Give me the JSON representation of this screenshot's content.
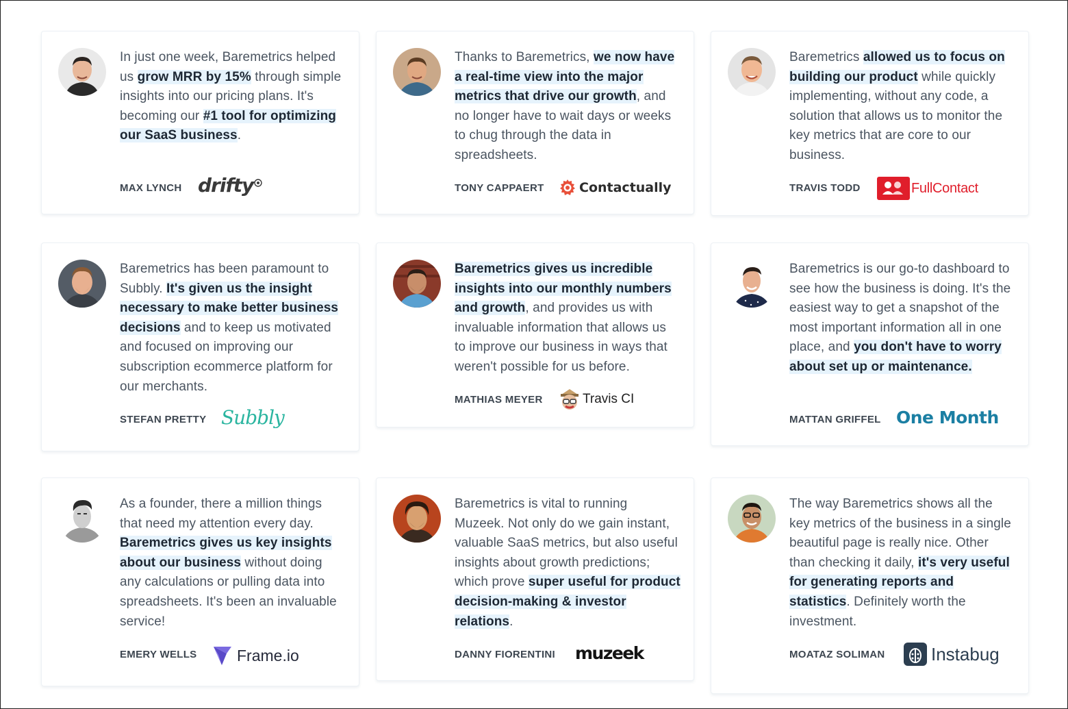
{
  "testimonials": [
    {
      "quote": [
        {
          "text": "In just one week, Baremetrics helped us ",
          "hl": false
        },
        {
          "text": "grow MRR by 15%",
          "hl": true
        },
        {
          "text": " through simple insights into our pricing plans. It's becoming our ",
          "hl": false
        },
        {
          "text": "#1 tool for optimizing our SaaS business",
          "hl": true
        },
        {
          "text": ".",
          "hl": false
        }
      ],
      "author": "MAX LYNCH",
      "logo": {
        "name": "drifty-logo",
        "text": "drifty",
        "color": "#3a3a3a"
      }
    },
    {
      "quote": [
        {
          "text": "Thanks to Baremetrics, ",
          "hl": false
        },
        {
          "text": "we now have a real-time view into the major metrics that drive our growth",
          "hl": true
        },
        {
          "text": ", and no longer have to wait days or weeks to chug through the data in spreadsheets.",
          "hl": false
        }
      ],
      "author": "TONY CAPPAERT",
      "logo": {
        "name": "contactually-logo",
        "text": "Contactually",
        "color": "#e8503a"
      }
    },
    {
      "quote": [
        {
          "text": "Baremetrics ",
          "hl": false
        },
        {
          "text": "allowed us to focus on building our product",
          "hl": true
        },
        {
          "text": " while quickly implementing, without any code, a solution that allows us to monitor the key metrics that are core to our business.",
          "hl": false
        }
      ],
      "author": "TRAVIS TODD",
      "logo": {
        "name": "fullcontact-logo",
        "text": "FullContact",
        "color": "#e01e2b"
      }
    },
    {
      "quote": [
        {
          "text": "Baremetrics has been paramount to Subbly. ",
          "hl": false
        },
        {
          "text": "It's given us the insight necessary to make better business decisions",
          "hl": true
        },
        {
          "text": " and to keep us motivated and focused on improving our subscription ecommerce platform for our merchants.",
          "hl": false
        }
      ],
      "author": "STEFAN PRETTY",
      "logo": {
        "name": "subbly-logo",
        "text": "Subbly",
        "color": "#2bb5a0"
      }
    },
    {
      "quote": [
        {
          "text": "Baremetrics gives us incredible insights into our monthly numbers and growth",
          "hl": true
        },
        {
          "text": ", and provides us with invaluable information that allows us to improve our business in ways that weren't possible for us before.",
          "hl": false
        }
      ],
      "author": "MATHIAS MEYER",
      "logo": {
        "name": "travis-ci-logo",
        "text": "Travis CI",
        "color": "#1f1f1f"
      }
    },
    {
      "quote": [
        {
          "text": "Baremetrics is our go-to dashboard to see how the business is doing. It's the easiest way to get a snapshot of the most important information all in one place, and ",
          "hl": false
        },
        {
          "text": "you don't have to worry about set up or maintenance.",
          "hl": true
        }
      ],
      "author": "MATTAN GRIFFEL",
      "logo": {
        "name": "one-month-logo",
        "text": "One Month",
        "color": "#1b7fa3"
      }
    },
    {
      "quote": [
        {
          "text": "As a founder, there a million things that need my attention every day. ",
          "hl": false
        },
        {
          "text": "Baremetrics gives us key insights about our business",
          "hl": true
        },
        {
          "text": " without doing any calculations or pulling data into spreadsheets. It's been an invaluable service!",
          "hl": false
        }
      ],
      "author": "EMERY WELLS",
      "logo": {
        "name": "frame-io-logo",
        "text": "Frame.io",
        "color": "#262a3a"
      }
    },
    {
      "quote": [
        {
          "text": "Baremetrics is vital to running Muzeek. Not only do we gain instant, valuable SaaS metrics, but also useful insights about growth predictions; which prove ",
          "hl": false
        },
        {
          "text": "super useful for product decision-making & investor relations",
          "hl": true
        },
        {
          "text": ".",
          "hl": false
        }
      ],
      "author": "DANNY FIORENTINI",
      "logo": {
        "name": "muzeek-logo",
        "text": "muzeek",
        "color": "#141414"
      }
    },
    {
      "quote": [
        {
          "text": "The way Baremetrics shows all the key metrics of the business in a single beautiful page is really nice. Other than checking it daily, ",
          "hl": false
        },
        {
          "text": "it's very useful for generating reports and statistics",
          "hl": true
        },
        {
          "text": ". Definitely worth the investment.",
          "hl": false
        }
      ],
      "author": "MOATAZ SOLIMAN",
      "logo": {
        "name": "instabug-logo",
        "text": "Instabug",
        "color": "#2c3e50"
      }
    }
  ]
}
